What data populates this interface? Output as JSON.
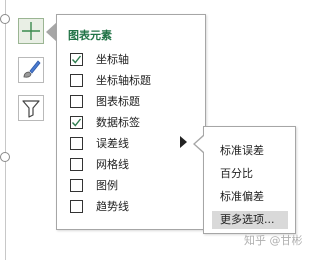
{
  "side_toolbar": {
    "buttons": [
      {
        "icon": "plus-icon",
        "active": true
      },
      {
        "icon": "paintbrush-icon",
        "active": false
      },
      {
        "icon": "filter-icon",
        "active": false
      }
    ]
  },
  "chart_elements_panel": {
    "title": "图表元素",
    "items": [
      {
        "label": "坐标轴",
        "checked": true
      },
      {
        "label": "坐标轴标题",
        "checked": false
      },
      {
        "label": "图表标题",
        "checked": false
      },
      {
        "label": "数据标签",
        "checked": true
      },
      {
        "label": "误差线",
        "checked": false,
        "has_submenu": true
      },
      {
        "label": "网格线",
        "checked": false
      },
      {
        "label": "图例",
        "checked": false
      },
      {
        "label": "趋势线",
        "checked": false
      }
    ]
  },
  "error_bar_submenu": {
    "items": [
      {
        "label": "标准误差"
      },
      {
        "label": "百分比"
      },
      {
        "label": "标准偏差"
      },
      {
        "label": "更多选项...",
        "hovered": true
      }
    ]
  },
  "watermark": "知乎 @甘彬",
  "colors": {
    "accent_green": "#217346",
    "check_green": "#2e7d4f",
    "hover_gray": "#d9d9d9"
  }
}
